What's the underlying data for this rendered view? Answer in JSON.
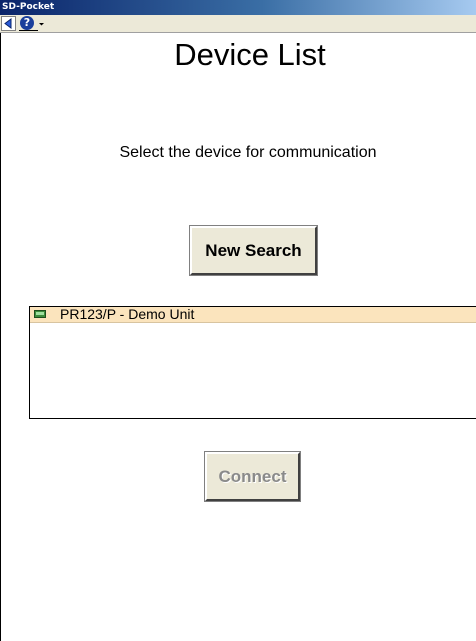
{
  "window": {
    "title": "SD-Pocket"
  },
  "toolbar": {
    "items": [
      {
        "name": "back",
        "icon": "back-arrow-icon"
      },
      {
        "name": "help",
        "icon": "help-icon",
        "glyph": "?"
      },
      {
        "name": "help-dropdown",
        "icon": "chevron-down-icon"
      }
    ]
  },
  "page": {
    "title": "Device List",
    "subtitle": "Select the device for communication",
    "new_search_label": "New Search",
    "connect_label": "Connect",
    "connect_enabled": false
  },
  "devices": [
    {
      "label": "PR123/P - Demo Unit",
      "icon": "device-icon",
      "selected": true
    }
  ],
  "colors": {
    "titlebar_start": "#0a246a",
    "titlebar_end": "#a6caf0",
    "selected_row": "#fbe4bd",
    "button_face": "#ece9d8",
    "disabled_text": "#8a8a8a"
  }
}
